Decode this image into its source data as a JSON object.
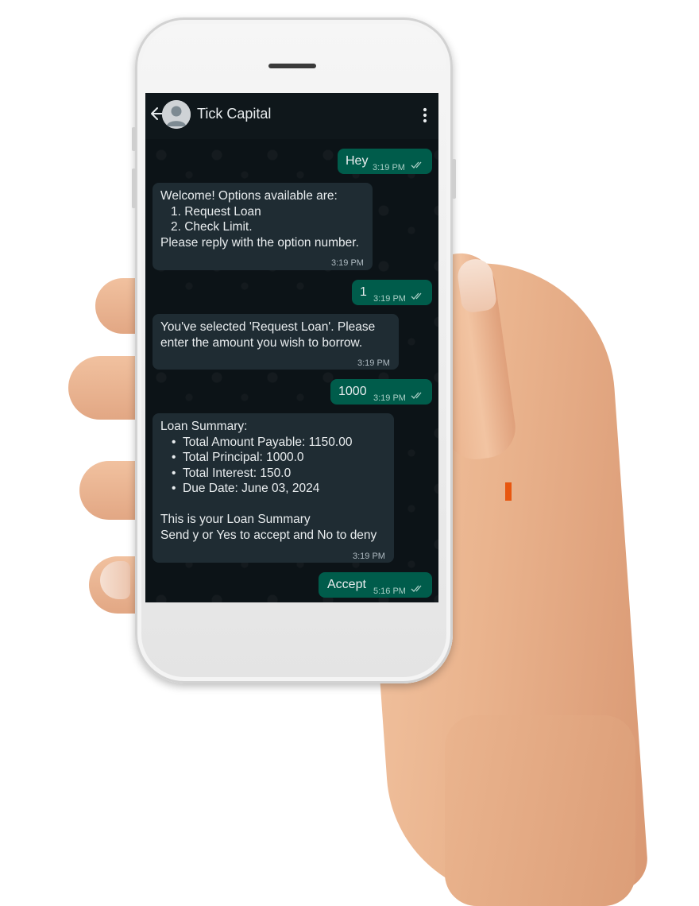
{
  "chat": {
    "contact_name": "Tick Capital",
    "messages": [
      {
        "from": "me",
        "text": "Hey",
        "time": "3:19 PM"
      },
      {
        "from": "them",
        "intro": "Welcome! Options available are:",
        "options": [
          "1. Request Loan",
          "2. Check Limit."
        ],
        "outro": "Please reply with the option number.",
        "time": "3:19 PM"
      },
      {
        "from": "me",
        "text": "1",
        "time": "3:19 PM"
      },
      {
        "from": "them",
        "lines": [
          "You've selected 'Request Loan'. Please",
          "enter the amount you wish to borrow."
        ],
        "time": "3:19 PM"
      },
      {
        "from": "me",
        "text": "1000",
        "time": "3:19 PM"
      },
      {
        "from": "them",
        "title": "Loan Summary:",
        "bullets": [
          "Total Amount Payable: 1150.00",
          "Total Principal: 1000.0",
          "Total Interest: 150.0",
          "Due Date: June 03, 2024"
        ],
        "closing": [
          "This is your Loan Summary",
          "Send y or Yes  to accept  and No to deny"
        ],
        "time": "3:19 PM"
      },
      {
        "from": "me",
        "text": "Accept",
        "time": "5:16 PM"
      }
    ]
  },
  "colors": {
    "incoming_bubble": "#1f2c33",
    "outgoing_bubble": "#005c4b",
    "header": "#0f171b",
    "read_ticks": "#a9cfc6"
  },
  "icons": {
    "back": "arrow-left-icon",
    "avatar": "default-person-icon",
    "menu": "vertical-dots-icon",
    "ticks": "double-check-icon"
  }
}
